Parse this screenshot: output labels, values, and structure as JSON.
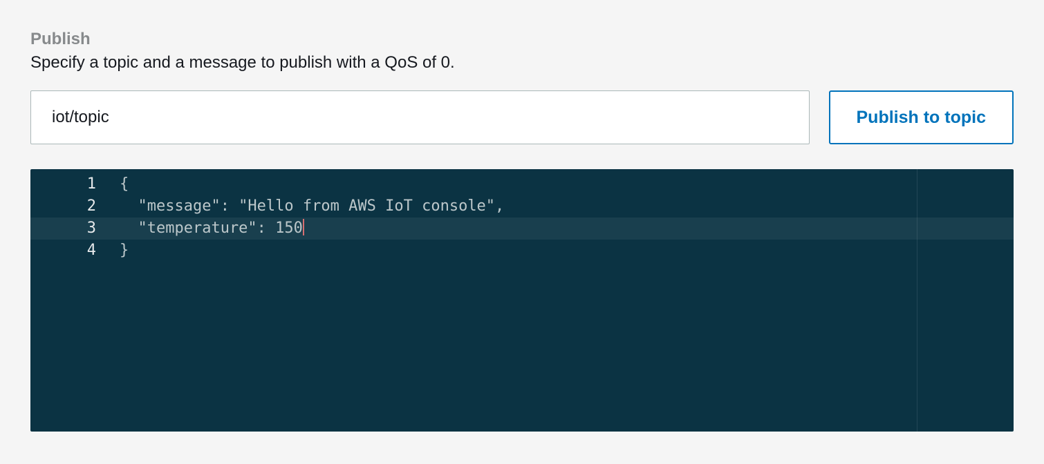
{
  "publish": {
    "heading": "Publish",
    "description": "Specify a topic and a message to publish with a QoS of 0.",
    "topic_value": "iot/topic",
    "button_label": "Publish to topic"
  },
  "editor": {
    "active_line_index": 2,
    "print_margin_column": 80,
    "lines": [
      {
        "num": "1",
        "text": "{"
      },
      {
        "num": "2",
        "text": "  \"message\": \"Hello from AWS IoT console\","
      },
      {
        "num": "3",
        "text": "  \"temperature\": 150"
      },
      {
        "num": "4",
        "text": "}"
      }
    ]
  }
}
